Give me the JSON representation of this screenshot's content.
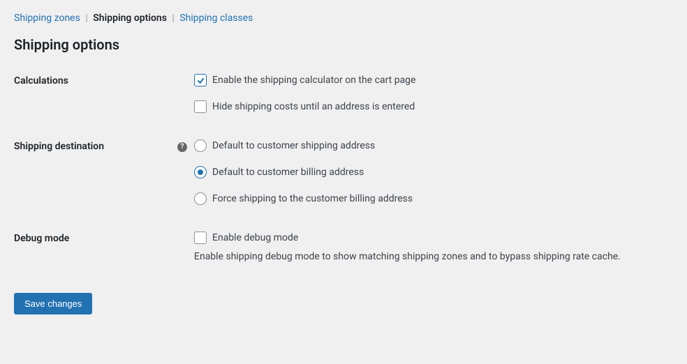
{
  "tabs": {
    "zones": "Shipping zones",
    "options": "Shipping options",
    "classes": "Shipping classes"
  },
  "page_title": "Shipping options",
  "sections": {
    "calculations": {
      "label": "Calculations",
      "enable_calculator": {
        "label": "Enable the shipping calculator on the cart page",
        "checked": true
      },
      "hide_costs": {
        "label": "Hide shipping costs until an address is entered",
        "checked": false
      }
    },
    "destination": {
      "label": "Shipping destination",
      "options": [
        {
          "label": "Default to customer shipping address",
          "selected": false
        },
        {
          "label": "Default to customer billing address",
          "selected": true
        },
        {
          "label": "Force shipping to the customer billing address",
          "selected": false
        }
      ]
    },
    "debug": {
      "label": "Debug mode",
      "enable": {
        "label": "Enable debug mode",
        "checked": false
      },
      "description": "Enable shipping debug mode to show matching shipping zones and to bypass shipping rate cache."
    }
  },
  "save_button": "Save changes",
  "help_tooltip": "?"
}
